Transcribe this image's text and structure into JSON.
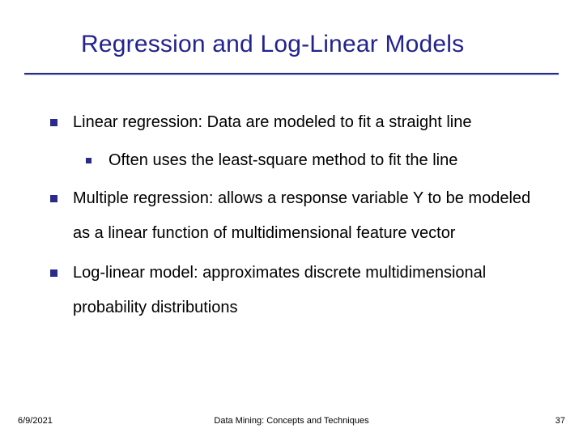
{
  "slide": {
    "title": "Regression and Log-Linear Models",
    "bullets": {
      "b1": "Linear regression: Data are modeled to fit a straight line",
      "b1_sub1": "Often uses the least-square method to fit the line",
      "b2": "Multiple regression: allows a response variable Y to be modeled as a linear function of multidimensional feature vector",
      "b3": "Log-linear model: approximates discrete multidimensional probability distributions"
    },
    "footer": {
      "date": "6/9/2021",
      "center": "Data Mining: Concepts and Techniques",
      "page": "37"
    }
  }
}
